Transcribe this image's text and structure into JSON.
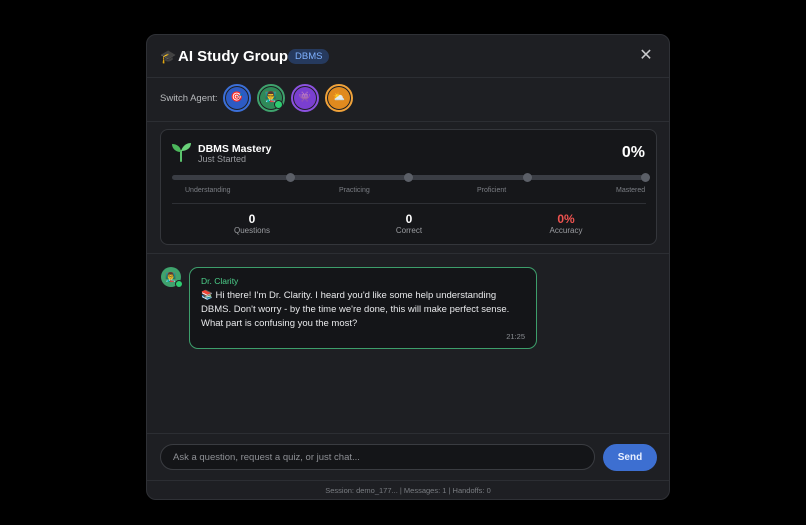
{
  "header": {
    "icon": "graduation-cap-icon",
    "icon_glyph": "🎓",
    "title": "AI Study Group",
    "badge": "DBMS",
    "close_glyph": "✕"
  },
  "agent_bar": {
    "label": "Switch Agent:",
    "agents": [
      {
        "icon": "target-icon",
        "glyph": "🎯",
        "ring": "#3b6fd8",
        "bg": "#2d5bc4"
      },
      {
        "icon": "teacher-icon",
        "glyph": "👨‍🏫",
        "ring": "#3fa36d",
        "bg": "#2f8a58",
        "active": true
      },
      {
        "icon": "monster-icon",
        "glyph": "👾",
        "ring": "#8c52e0",
        "bg": "#7a3fd0"
      },
      {
        "icon": "sun-behind-cloud-icon",
        "glyph": "⛅",
        "ring": "#f0a23a",
        "bg": "#e08a1e"
      }
    ]
  },
  "mastery": {
    "icon": "seedling-icon",
    "title": "DBMS Mastery",
    "status": "Just Started",
    "percent_label": "0%",
    "progress": 0,
    "stages": [
      "Understanding",
      "Practicing",
      "Proficient",
      "Mastered"
    ],
    "stats": [
      {
        "value": "0",
        "label": "Questions",
        "color": "#ffffff"
      },
      {
        "value": "0",
        "label": "Correct",
        "color": "#ffffff"
      },
      {
        "value": "0%",
        "label": "Accuracy",
        "color": "#ef5350"
      }
    ]
  },
  "chat": {
    "messages": [
      {
        "avatar_icon": "teacher-icon",
        "avatar_glyph": "👨‍🏫",
        "sender": "Dr. Clarity",
        "text": "📚 Hi there! I'm Dr. Clarity. I heard you'd like some help understanding DBMS. Don't worry - by the time we're done, this will make perfect sense. What part is confusing you the most?",
        "time": "21:25"
      }
    ]
  },
  "input": {
    "placeholder": "Ask a question, request a quiz, or just chat...",
    "value": "",
    "send_label": "Send"
  },
  "footer": {
    "text": "Session: demo_177... | Messages: 1 | Handoffs: 0"
  },
  "colors": {
    "accent_blue": "#3d6fd1",
    "accent_green": "#3d9e6b",
    "danger": "#ef5350"
  }
}
